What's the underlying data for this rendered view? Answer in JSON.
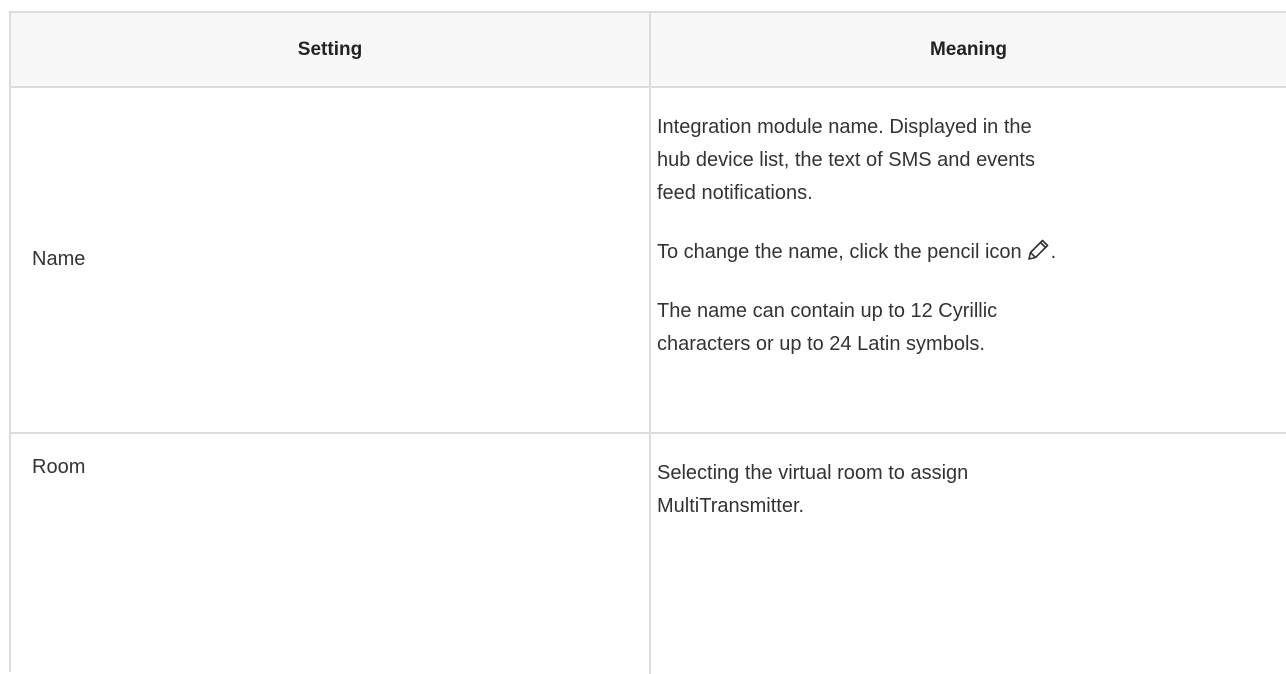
{
  "table": {
    "headers": {
      "setting": "Setting",
      "meaning": "Meaning"
    },
    "rows": [
      {
        "setting": "Name",
        "meaning": {
          "p1": "Integration module name. Displayed in the hub device list, the text of SMS and events feed notifications.",
          "p2": "To change the name, click the pencil icon",
          "p2_end": ".",
          "p3": "The name can contain up to 12 Cyrillic characters or up to 24 Latin symbols."
        }
      },
      {
        "setting": "Room",
        "meaning": {
          "p1": "Selecting the virtual room to assign MultiTransmitter."
        }
      }
    ]
  },
  "icons": {
    "pencil": "pencil-icon"
  }
}
